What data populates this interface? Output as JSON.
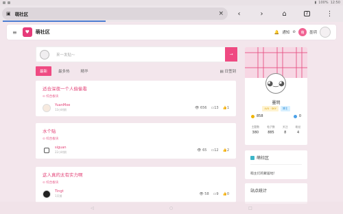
{
  "statusbar": {
    "time": "12:50",
    "battery": "100%"
  },
  "browser": {
    "tab_title": "萌社区",
    "close": "×",
    "back": "‹",
    "forward": "›",
    "home": "⌂",
    "tabs_count": "2",
    "menu": "⋮"
  },
  "header": {
    "menu": "≡",
    "site_name": "萌社区",
    "notify_label": "通知",
    "user_short": "萌",
    "user_name": "墨玥",
    "at": "⊘"
  },
  "search": {
    "placeholder": "来一发贴～",
    "button": "→"
  },
  "tabs": [
    {
      "label": "最新"
    },
    {
      "label": "最多热"
    },
    {
      "label": "精华"
    }
  ],
  "checkin": "日签到",
  "posts": [
    {
      "title": "适合深夜一个人偷偷看",
      "tag": "综合板块",
      "user": "YuanMoe",
      "time": "13小时前",
      "views": "656",
      "comments": "13",
      "likes": "1"
    },
    {
      "title": "水个贴",
      "tag": "综合板块",
      "user": "siguan",
      "time": "22小时前",
      "views": "65",
      "comments": "12",
      "likes": "2"
    },
    {
      "title": "这人真的太有实力啊",
      "tag": "综合板块",
      "user": "Tingt",
      "time": "1天前",
      "views": "58",
      "comments": "9",
      "likes": "0"
    }
  ],
  "profile": {
    "name": "墨玥",
    "level_badge": "LV0 · SKY",
    "role_badge": "博主",
    "coins": "858",
    "gems": "0",
    "counts": [
      {
        "label": "主题数",
        "value": "380"
      },
      {
        "label": "帖子数",
        "value": "885"
      },
      {
        "label": "关注",
        "value": "8"
      },
      {
        "label": "粉丝",
        "value": "4"
      }
    ]
  },
  "community_card": {
    "title": "萌社区",
    "subtitle": "萌主们的聚居地!"
  },
  "stats_card": {
    "title": "站点统计"
  },
  "colors": {
    "accent": "#ef4a82",
    "link": "#e23e74"
  }
}
